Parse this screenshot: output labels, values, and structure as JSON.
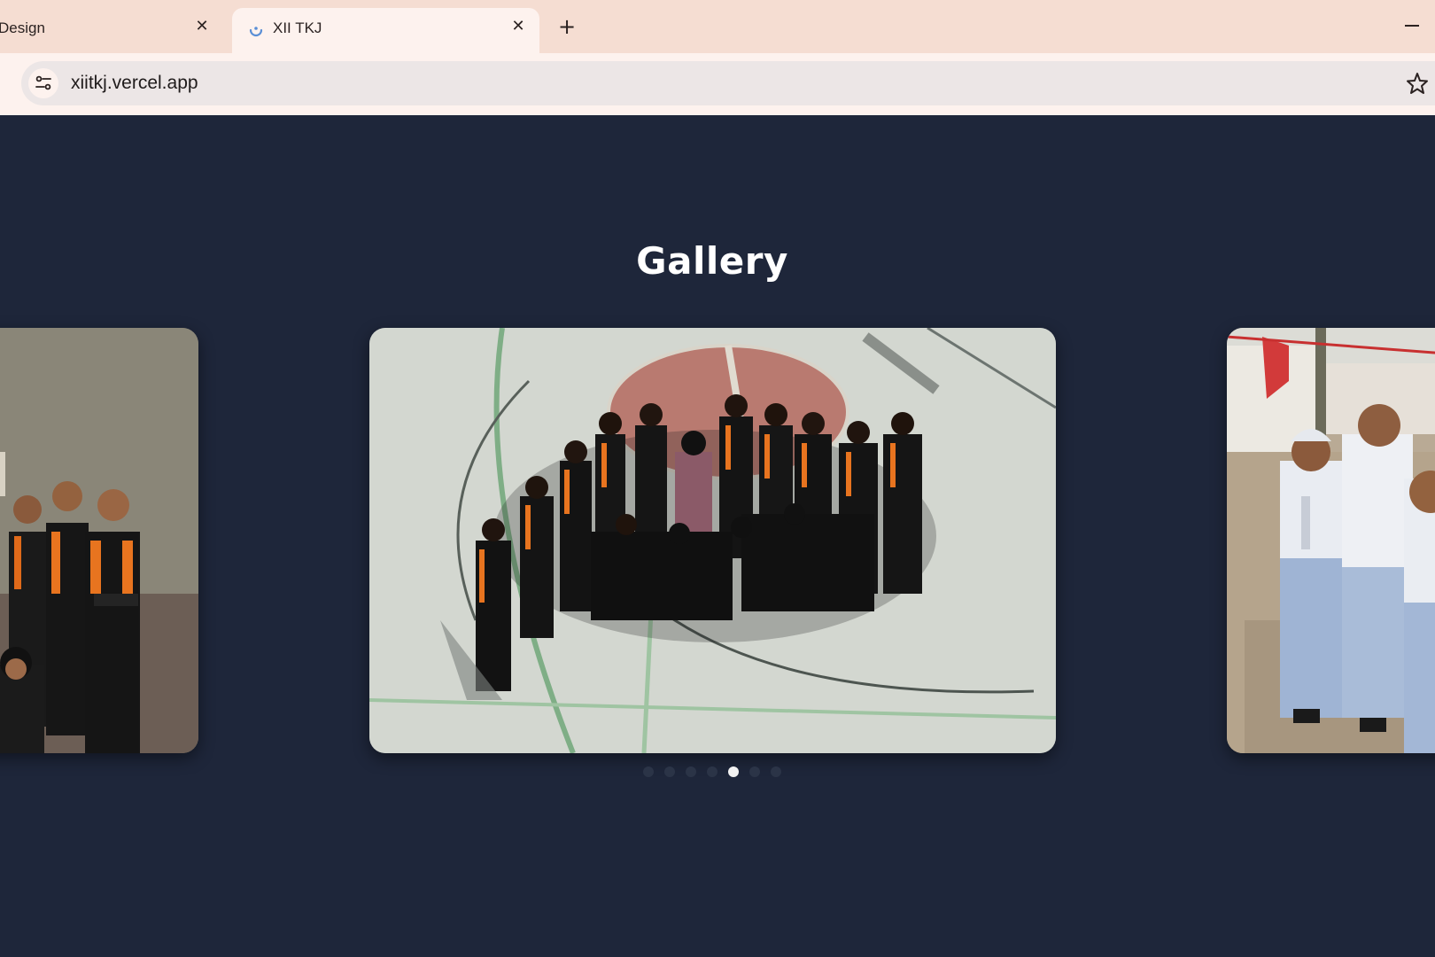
{
  "browser": {
    "tabs": [
      {
        "title": "Design",
        "active": false
      },
      {
        "title": "XII TKJ",
        "active": true
      }
    ],
    "url": "xiitkj.vercel.app"
  },
  "page": {
    "heading": "Gallery",
    "carousel": {
      "slide_count": 7,
      "active_index": 4,
      "slides": [
        {
          "position": "previous",
          "description": "students in black-orange uniforms posing indoors"
        },
        {
          "position": "current",
          "description": "aerial group photo of class on school court"
        },
        {
          "position": "next",
          "description": "students in white-grey school uniforms posing outdoors"
        }
      ]
    }
  },
  "colors": {
    "background": "#1e263a",
    "tabstrip": "#f5ddd2",
    "active_tab": "#fdf2ee",
    "dot_active": "#f2f2f2",
    "dot_inactive": "#2b3447"
  }
}
